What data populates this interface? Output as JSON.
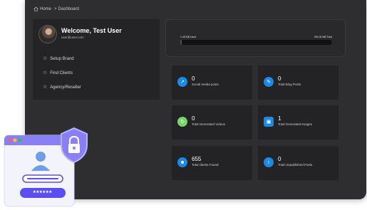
{
  "breadcrumb": {
    "home": "Home",
    "separator": ">",
    "current": "Dashboard"
  },
  "profile": {
    "welcome": "Welcome, Test User",
    "email": "user@user.com"
  },
  "menu": [
    {
      "label": "Setup Brand",
      "icon": "star-icon"
    },
    {
      "label": "Find Clients",
      "icon": "star-icon"
    },
    {
      "label": "Agency/Reseller",
      "icon": "star-icon"
    }
  ],
  "usage": {
    "left_label": "1.48 MB Used",
    "right_label": "300.00 MB Total",
    "fraction_used": 0.005
  },
  "stats": [
    {
      "value": "0",
      "label": "Social media posts",
      "icon": "share-icon",
      "color": "#1e88e5"
    },
    {
      "value": "0",
      "label": "Total Blog Posts",
      "icon": "blog-icon",
      "color": "#1e88e5"
    },
    {
      "value": "0",
      "label": "Total Generated Videos",
      "icon": "video-icon",
      "color": "#7bd36b"
    },
    {
      "value": "1",
      "label": "Total Generated Images",
      "icon": "image-icon",
      "color": "#1e88e5"
    },
    {
      "value": "655",
      "label": "Total clients Found",
      "icon": "users-icon",
      "color": "#1e88e5"
    },
    {
      "value": "0",
      "label": "Total Unpublished Posts",
      "icon": "info-icon",
      "color": "#1e88e5"
    }
  ],
  "illustration": {
    "password_mask": "******",
    "colors": {
      "accent": "#5b4ef0",
      "shield": "#8a7ff5",
      "window": "#f2f3fb"
    }
  }
}
